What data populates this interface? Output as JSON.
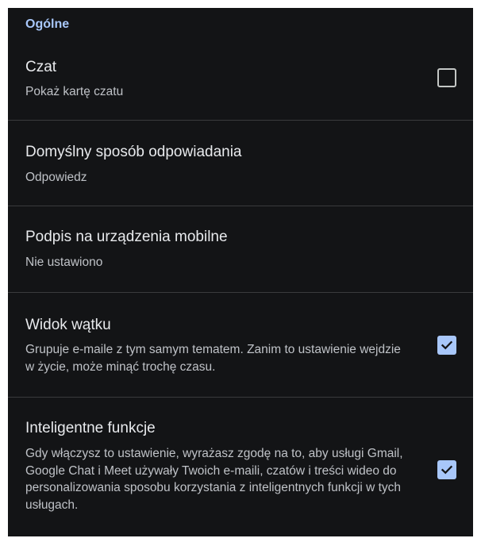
{
  "section": {
    "title": "Ogólne"
  },
  "settings": [
    {
      "title": "Czat",
      "subtitle": "Pokaż kartę czatu",
      "checkbox": "unchecked"
    },
    {
      "title": "Domyślny sposób odpowiadania",
      "subtitle": "Odpowiedz"
    },
    {
      "title": "Podpis na urządzenia mobilne",
      "subtitle": "Nie ustawiono"
    },
    {
      "title": "Widok wątku",
      "subtitle": "Grupuje e-maile z tym samym tematem. Zanim to ustawienie wejdzie w życie, może minąć trochę czasu.",
      "checkbox": "checked"
    },
    {
      "title": "Inteligentne funkcje",
      "subtitle": "Gdy włączysz to ustawienie, wyrażasz zgodę na to, aby usługi Gmail, Google Chat i Meet używały Twoich e-maili, czatów i treści wideo do personalizowania sposobu korzystania z inteligentnych funkcji w tych usługach.",
      "checkbox": "checked"
    }
  ],
  "colors": {
    "background": "#131416",
    "accent": "#a8c7fa",
    "title_text": "#e8eaed",
    "subtitle_text": "#bfc2c7",
    "divider": "#3a3b3d"
  }
}
